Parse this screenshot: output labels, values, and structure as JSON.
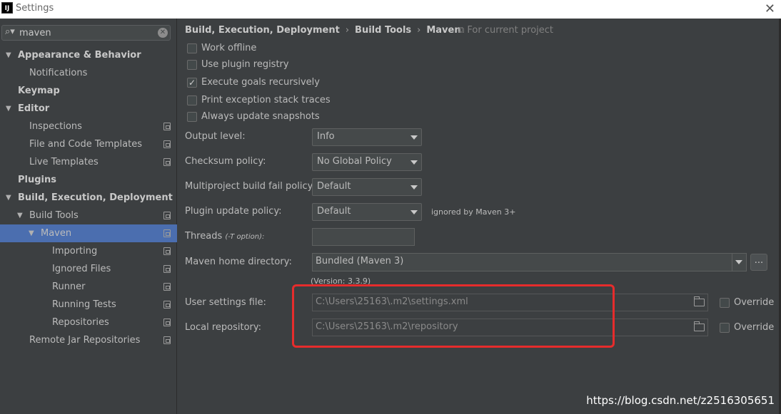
{
  "window": {
    "title": "Settings",
    "logo_text": "IJ",
    "close_glyph": "✕"
  },
  "sidebar": {
    "search": {
      "value": "maven",
      "icon": "search-icon",
      "clear_glyph": "✕"
    },
    "items": [
      {
        "label": "Appearance & Behavior",
        "bold": true,
        "expanded": true,
        "level": 0
      },
      {
        "label": "Notifications",
        "level": 1
      },
      {
        "label": "Keymap",
        "bold": true,
        "level": 0
      },
      {
        "label": "Editor",
        "bold": true,
        "expanded": true,
        "level": 0
      },
      {
        "label": "Inspections",
        "level": 1,
        "project_icon": true
      },
      {
        "label": "File and Code Templates",
        "level": 1,
        "project_icon": true
      },
      {
        "label": "Live Templates",
        "level": 1,
        "project_icon": true
      },
      {
        "label": "Plugins",
        "bold": true,
        "level": 0
      },
      {
        "label": "Build, Execution, Deployment",
        "bold": true,
        "expanded": true,
        "level": 0
      },
      {
        "label": "Build Tools",
        "level": 1,
        "expanded": true,
        "project_icon": true
      },
      {
        "label": "Maven",
        "level": 2,
        "expanded": true,
        "selected": true,
        "project_icon": true
      },
      {
        "label": "Importing",
        "level": 3,
        "project_icon": true
      },
      {
        "label": "Ignored Files",
        "level": 3,
        "project_icon": true
      },
      {
        "label": "Runner",
        "level": 3,
        "project_icon": true
      },
      {
        "label": "Running Tests",
        "level": 3,
        "project_icon": true
      },
      {
        "label": "Repositories",
        "level": 3,
        "project_icon": true
      },
      {
        "label": "Remote Jar Repositories",
        "level": 1,
        "project_icon": true
      }
    ]
  },
  "breadcrumb": {
    "parts": [
      "Build, Execution, Deployment",
      "Build Tools",
      "Maven"
    ],
    "separator": "›",
    "scope": "For current project"
  },
  "checkboxes": [
    {
      "label": "Work offline",
      "checked": false
    },
    {
      "label": "Use plugin registry",
      "checked": false
    },
    {
      "label": "Execute goals recursively",
      "checked": true
    },
    {
      "label": "Print exception stack traces",
      "checked": false
    },
    {
      "label": "Always update snapshots",
      "checked": false
    }
  ],
  "fields": {
    "output_level": {
      "label": "Output level:",
      "value": "Info"
    },
    "checksum_policy": {
      "label": "Checksum policy:",
      "value": "No Global Policy"
    },
    "fail_policy": {
      "label": "Multiproject build fail policy:",
      "value": "Default"
    },
    "plugin_update": {
      "label": "Plugin update policy:",
      "value": "Default",
      "note": "ignored by Maven 3+"
    },
    "threads": {
      "label": "Threads",
      "hint": "(-T option):",
      "value": ""
    },
    "maven_home": {
      "label": "Maven home directory:",
      "value": "Bundled (Maven 3)",
      "button": "...",
      "version": "(Version: 3.3.9)"
    },
    "user_settings": {
      "label": "User settings file:",
      "value": "C:\\Users\\25163\\.m2\\settings.xml",
      "override": "Override"
    },
    "local_repo": {
      "label": "Local repository:",
      "value": "C:\\Users\\25163\\.m2\\repository",
      "override": "Override"
    }
  },
  "watermark": "https://blog.csdn.net/z2516305651",
  "colors": {
    "accent": "#4b6eaf",
    "highlight_box": "#e62c2c",
    "background": "#3c3f41"
  }
}
